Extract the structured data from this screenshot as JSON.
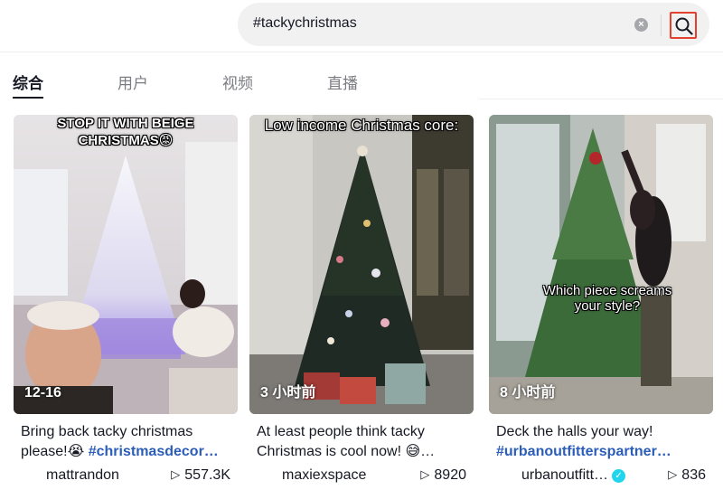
{
  "search": {
    "query": "#tackychristmas",
    "clear_icon": "clear-circle-icon",
    "search_icon": "magnifier-icon",
    "accent_color": "#e5402c"
  },
  "tabs": [
    {
      "label": "综合",
      "active": true
    },
    {
      "label": "用户",
      "active": false
    },
    {
      "label": "视频",
      "active": false
    },
    {
      "label": "直播",
      "active": false
    }
  ],
  "videos": [
    {
      "overlay_text": "STOP IT WITH BEIGE CHRISTMAS😡",
      "time": "12-16",
      "description_line1": "Bring back tacky christmas",
      "description_line2_text": "please!😭 ",
      "description_line2_tag": "#christmasdecor…",
      "author": "mattrandon",
      "verified": false,
      "views": "557.3K"
    },
    {
      "overlay_text": "Low income Christmas core:",
      "time": "3 小时前",
      "description_line1": "At least people think tacky",
      "description_line2_text": "Christmas is cool now! 😅…",
      "description_line2_tag": "",
      "author": "maxiexspace",
      "verified": false,
      "views": "8920"
    },
    {
      "overlay_text": "Which piece screams your style?",
      "time": "8 小时前",
      "description_line1": "Deck the halls your way!",
      "description_line2_text": "",
      "description_line2_tag": "#urbanoutfitterspartner…",
      "author": "urbanoutfitt…",
      "verified": true,
      "views": "836"
    }
  ],
  "icons": {
    "play": "play-icon",
    "verified": "verified-badge-icon"
  }
}
